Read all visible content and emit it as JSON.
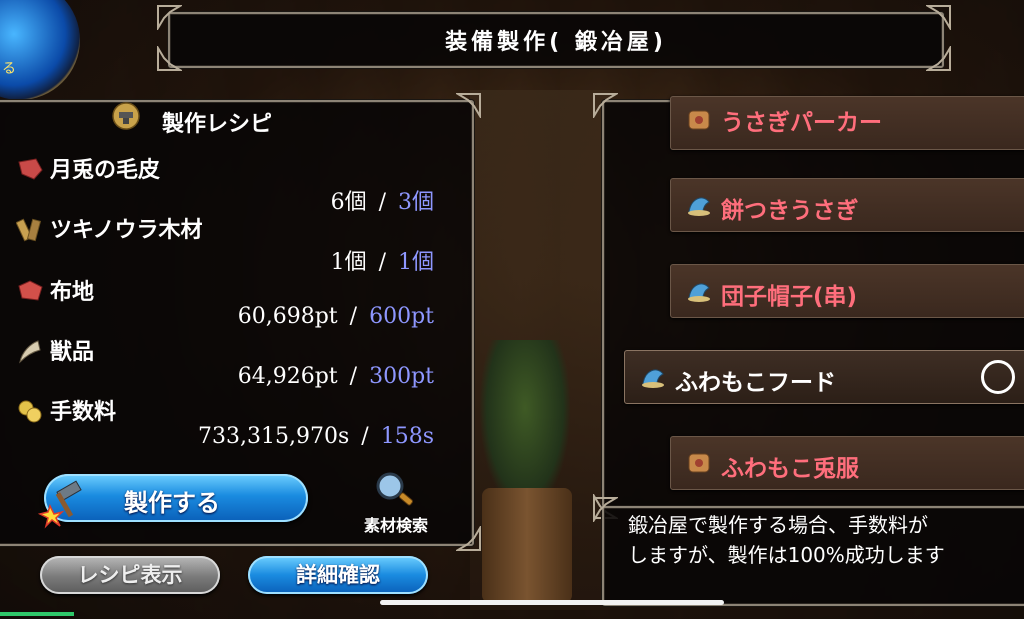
{
  "header": {
    "title": "装備製作( 鍛冶屋)"
  },
  "orb": {
    "label": "る"
  },
  "recipe": {
    "title": "製作レシピ",
    "ingredients": [
      {
        "name": "月兎の毛皮",
        "icon": "fur-icon",
        "have": "6個",
        "sep": "/",
        "need": "3個"
      },
      {
        "name": "ツキノウラ木材",
        "icon": "wood-icon",
        "have": "1個",
        "sep": "/",
        "need": "1個"
      },
      {
        "name": "布地",
        "icon": "cloth-icon",
        "have": "60,698pt",
        "sep": "/",
        "need": "600pt"
      },
      {
        "name": "獣品",
        "icon": "fang-icon",
        "have": "64,926pt",
        "sep": "/",
        "need": "300pt"
      },
      {
        "name": "手数料",
        "icon": "coin-icon",
        "have": "733,315,970s",
        "sep": "/",
        "need": "158s"
      }
    ],
    "craft_label": "製作する",
    "search_label": "素材検索"
  },
  "bottom": {
    "recipe_label": "レシピ表示",
    "detail_label": "詳細確認"
  },
  "items": [
    {
      "label": "うさぎパーカー",
      "icon": "armor-icon"
    },
    {
      "label": "餅つきうさぎ",
      "icon": "hat-icon"
    },
    {
      "label": "団子帽子(串)",
      "icon": "hat-icon"
    },
    {
      "label": "ふわもこフード",
      "icon": "hat-icon"
    },
    {
      "label": "ふわもこ兎服",
      "icon": "armor-icon"
    }
  ],
  "description": {
    "line1": "鍛冶屋で製作する場合、手数料が",
    "line2": "しますが、製作は100%成功します"
  },
  "colors": {
    "need": "#8e97ff",
    "item_red": "#ff6e7c",
    "button_blue": "#1a8be0"
  }
}
